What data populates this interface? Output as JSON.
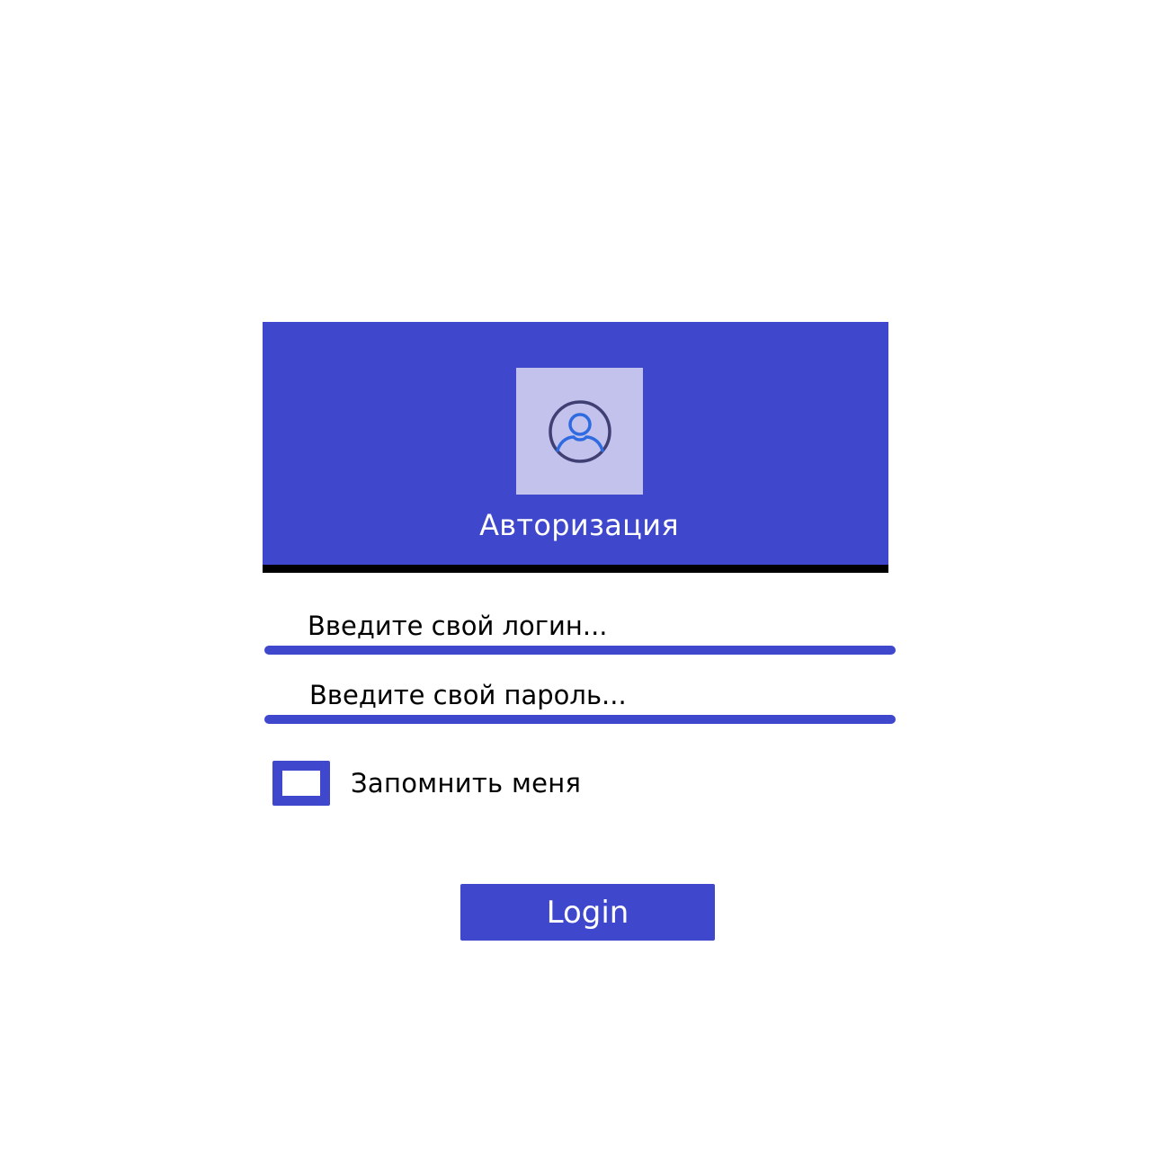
{
  "colors": {
    "accent": "#3f48cc",
    "avatar_background": "#c2c2ec",
    "header_rule": "#000000",
    "background": "#ffffff"
  },
  "header": {
    "avatar_icon": "user-circle-icon",
    "title": "Авторизация"
  },
  "form": {
    "login": {
      "value": "",
      "placeholder": "Введите свой логин..."
    },
    "password": {
      "value": "",
      "placeholder": "Введите свой пароль..."
    },
    "remember_me": {
      "label": "Запомнить меня",
      "checked": false
    },
    "submit_label": "Login"
  }
}
